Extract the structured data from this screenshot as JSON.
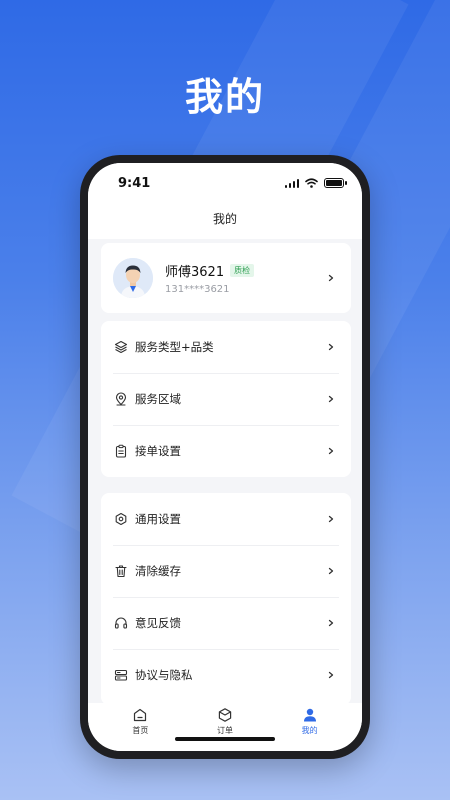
{
  "promo": {
    "title": "我的"
  },
  "status_bar": {
    "time": "9:41"
  },
  "nav": {
    "title": "我的"
  },
  "profile": {
    "name": "师傅3621",
    "badge": "质检",
    "phone": "131****3621"
  },
  "menu_group_1": [
    {
      "label": "服务类型+品类",
      "icon": "layers-icon"
    },
    {
      "label": "服务区域",
      "icon": "location-pin-icon"
    },
    {
      "label": "接单设置",
      "icon": "clipboard-icon"
    }
  ],
  "menu_group_2": [
    {
      "label": "通用设置",
      "icon": "gear-icon"
    },
    {
      "label": "清除缓存",
      "icon": "trash-icon"
    },
    {
      "label": "意见反馈",
      "icon": "headset-icon"
    },
    {
      "label": "协议与隐私",
      "icon": "document-icon"
    }
  ],
  "tab_bar": [
    {
      "label": "首页",
      "icon": "home-icon",
      "active": false
    },
    {
      "label": "订单",
      "icon": "box-icon",
      "active": false
    },
    {
      "label": "我的",
      "icon": "user-icon",
      "active": true
    }
  ],
  "colors": {
    "accent": "#2f6ae6",
    "badge_text": "#2f9e52",
    "badge_bg": "#e4f6ea"
  }
}
